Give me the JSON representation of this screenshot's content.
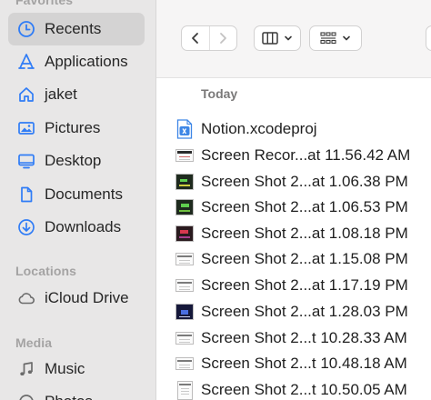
{
  "sidebar": {
    "sections": {
      "favorites": "Favorites",
      "locations": "Locations",
      "media": "Media"
    },
    "favorites": [
      {
        "label": "Recents",
        "icon": "clock-icon",
        "selected": true
      },
      {
        "label": "Applications",
        "icon": "applications-icon"
      },
      {
        "label": "jaket",
        "icon": "home-icon"
      },
      {
        "label": "Pictures",
        "icon": "pictures-icon"
      },
      {
        "label": "Desktop",
        "icon": "desktop-icon"
      },
      {
        "label": "Documents",
        "icon": "document-icon"
      },
      {
        "label": "Downloads",
        "icon": "downloads-icon"
      }
    ],
    "locations": [
      {
        "label": "iCloud Drive",
        "icon": "cloud-icon"
      }
    ],
    "media": [
      {
        "label": "Music",
        "icon": "music-icon"
      },
      {
        "label": "Photos",
        "icon": "photos-icon"
      }
    ]
  },
  "toolbar": {
    "back_icon": "chevron-left-icon",
    "forward_icon": "chevron-right-icon",
    "view_mode_icon": "columns-view-icon",
    "group_icon": "grid-group-icon"
  },
  "main": {
    "group_header": "Today",
    "files": [
      {
        "name": "Notion.xcodeproj",
        "icon": "xcodeproj-icon"
      },
      {
        "name": "Screen Recor...at 11.56.42 AM",
        "icon": "screen-recording-thumbnail"
      },
      {
        "name": "Screen Shot 2...at 1.06.38 PM",
        "icon": "screenshot-thumbnail-green"
      },
      {
        "name": "Screen Shot 2...at 1.06.53 PM",
        "icon": "screenshot-thumbnail-green"
      },
      {
        "name": "Screen Shot 2...at 1.08.18 PM",
        "icon": "screenshot-thumbnail-red"
      },
      {
        "name": "Screen Shot 2...at 1.15.08 PM",
        "icon": "screenshot-thumbnail-doc"
      },
      {
        "name": "Screen Shot 2...at 1.17.19 PM",
        "icon": "screenshot-thumbnail-doc"
      },
      {
        "name": "Screen Shot 2...at 1.28.03 PM",
        "icon": "screenshot-thumbnail-blue"
      },
      {
        "name": "Screen Shot 2...t 10.28.33 AM",
        "icon": "screenshot-thumbnail-doc"
      },
      {
        "name": "Screen Shot 2...t 10.48.18 AM",
        "icon": "screenshot-thumbnail-doc"
      },
      {
        "name": "Screen Shot 2...t 10.50.05 AM",
        "icon": "screenshot-thumbnail-page"
      }
    ]
  },
  "colors": {
    "accent": "#2f7cf6",
    "sidebar_bg": "#e8e7e7",
    "selected_bg": "#d4d3d3"
  }
}
